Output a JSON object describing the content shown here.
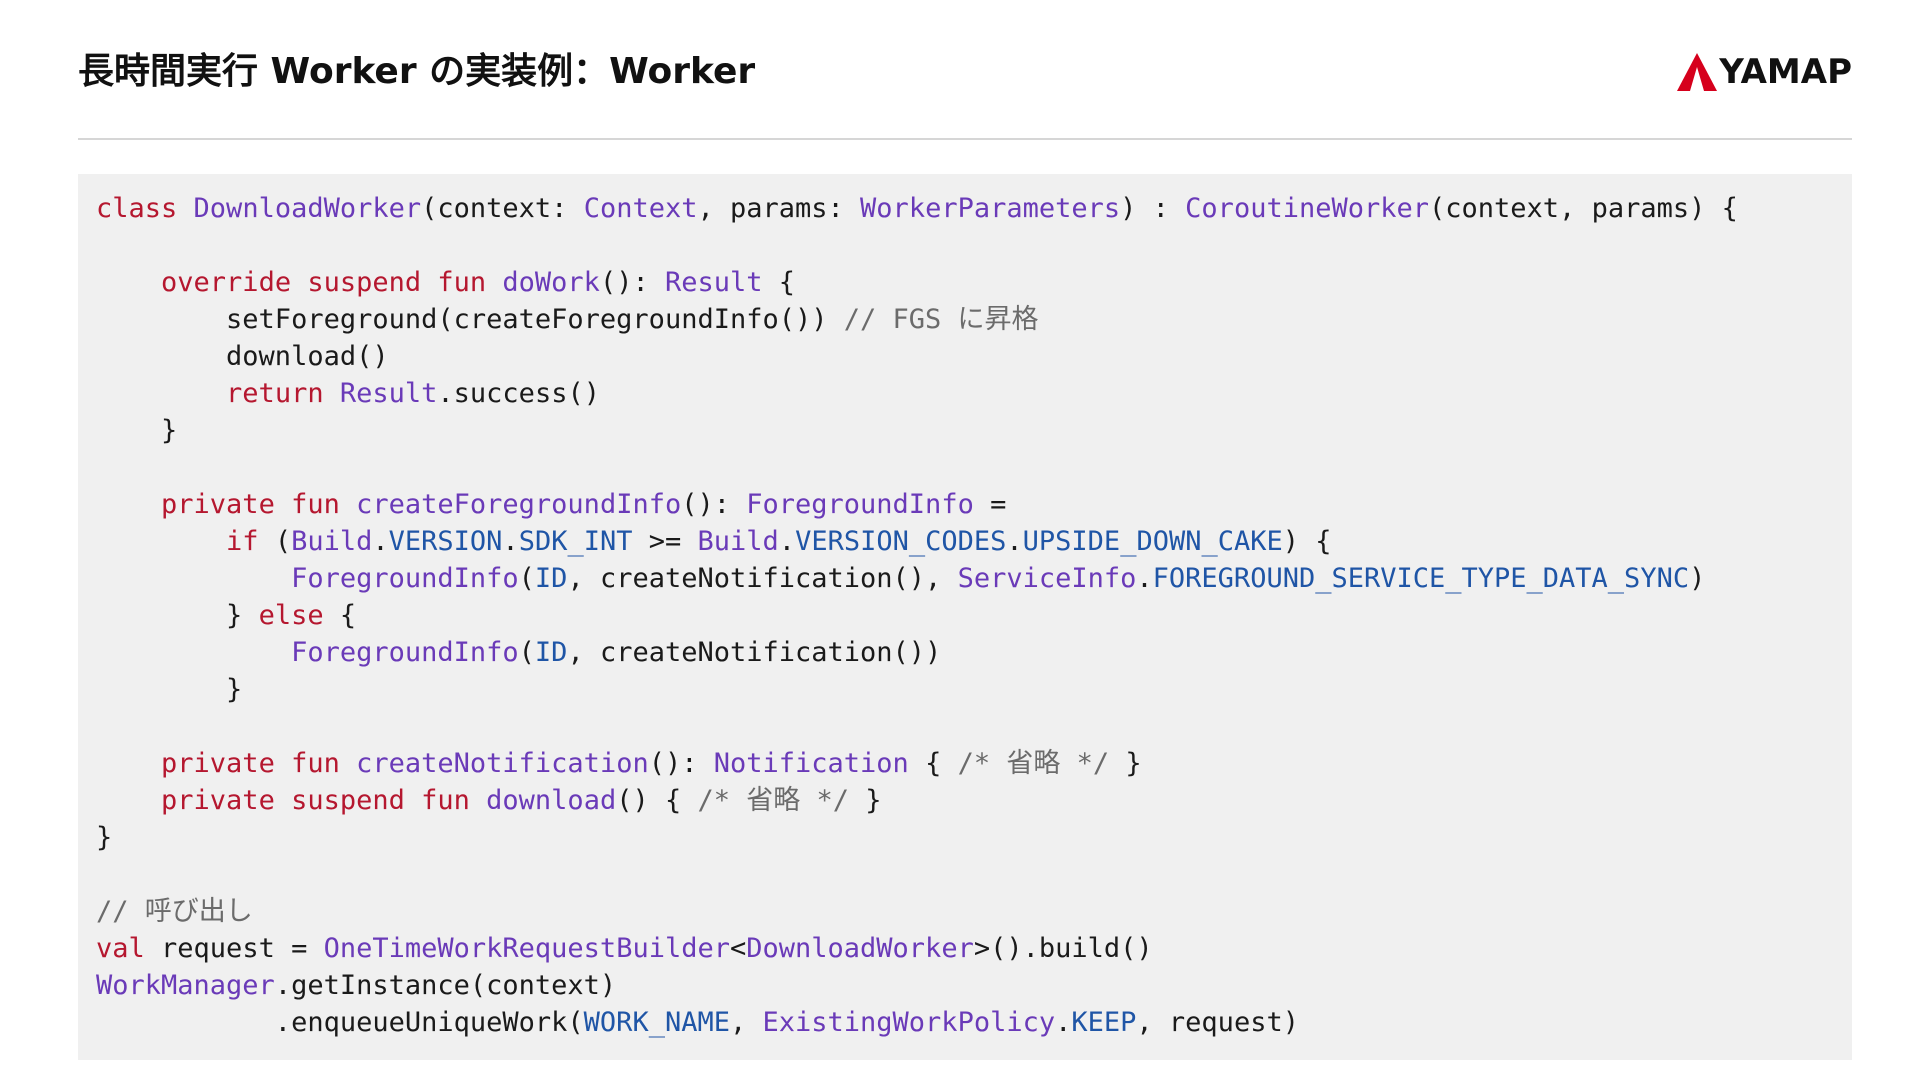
{
  "slide": {
    "title": "長時間実行 Worker の実装例：Worker",
    "logo_text": "YAMAP",
    "brand_color": "#d6001c"
  },
  "code_lines": [
    [
      {
        "t": "kw",
        "v": "class"
      },
      {
        "t": "p",
        "v": " "
      },
      {
        "t": "ty",
        "v": "DownloadWorker"
      },
      {
        "t": "p",
        "v": "(context: "
      },
      {
        "t": "ty",
        "v": "Context"
      },
      {
        "t": "p",
        "v": ", params: "
      },
      {
        "t": "ty",
        "v": "WorkerParameters"
      },
      {
        "t": "p",
        "v": ") : "
      },
      {
        "t": "ty",
        "v": "CoroutineWorker"
      },
      {
        "t": "p",
        "v": "(context, params) {"
      }
    ],
    [],
    [
      {
        "t": "p",
        "v": "    "
      },
      {
        "t": "kw",
        "v": "override suspend fun"
      },
      {
        "t": "p",
        "v": " "
      },
      {
        "t": "ty",
        "v": "doWork"
      },
      {
        "t": "p",
        "v": "(): "
      },
      {
        "t": "ty",
        "v": "Result"
      },
      {
        "t": "p",
        "v": " {"
      }
    ],
    [
      {
        "t": "p",
        "v": "        setForeground(createForegroundInfo()) "
      },
      {
        "t": "cm",
        "v": "// FGS に昇格"
      }
    ],
    [
      {
        "t": "p",
        "v": "        download()"
      }
    ],
    [
      {
        "t": "p",
        "v": "        "
      },
      {
        "t": "kw",
        "v": "return"
      },
      {
        "t": "p",
        "v": " "
      },
      {
        "t": "ty",
        "v": "Result"
      },
      {
        "t": "p",
        "v": ".success()"
      }
    ],
    [
      {
        "t": "p",
        "v": "    }"
      }
    ],
    [],
    [
      {
        "t": "p",
        "v": "    "
      },
      {
        "t": "kw",
        "v": "private fun"
      },
      {
        "t": "p",
        "v": " "
      },
      {
        "t": "ty",
        "v": "createForegroundInfo"
      },
      {
        "t": "p",
        "v": "(): "
      },
      {
        "t": "ty",
        "v": "ForegroundInfo"
      },
      {
        "t": "p",
        "v": " ="
      }
    ],
    [
      {
        "t": "p",
        "v": "        "
      },
      {
        "t": "kw",
        "v": "if"
      },
      {
        "t": "p",
        "v": " ("
      },
      {
        "t": "ty",
        "v": "Build"
      },
      {
        "t": "p",
        "v": "."
      },
      {
        "t": "cn",
        "v": "VERSION"
      },
      {
        "t": "p",
        "v": "."
      },
      {
        "t": "cn",
        "v": "SDK_INT"
      },
      {
        "t": "p",
        "v": " >= "
      },
      {
        "t": "ty",
        "v": "Build"
      },
      {
        "t": "p",
        "v": "."
      },
      {
        "t": "cn",
        "v": "VERSION_CODES"
      },
      {
        "t": "p",
        "v": "."
      },
      {
        "t": "cn",
        "v": "UPSIDE_DOWN_CAKE"
      },
      {
        "t": "p",
        "v": ") {"
      }
    ],
    [
      {
        "t": "p",
        "v": "            "
      },
      {
        "t": "ty",
        "v": "ForegroundInfo"
      },
      {
        "t": "p",
        "v": "("
      },
      {
        "t": "cn",
        "v": "ID"
      },
      {
        "t": "p",
        "v": ", createNotification(), "
      },
      {
        "t": "ty",
        "v": "ServiceInfo"
      },
      {
        "t": "p",
        "v": "."
      },
      {
        "t": "cn",
        "v": "FOREGROUND_SERVICE_TYPE_DATA_SYNC"
      },
      {
        "t": "p",
        "v": ")"
      }
    ],
    [
      {
        "t": "p",
        "v": "        } "
      },
      {
        "t": "kw",
        "v": "else"
      },
      {
        "t": "p",
        "v": " {"
      }
    ],
    [
      {
        "t": "p",
        "v": "            "
      },
      {
        "t": "ty",
        "v": "ForegroundInfo"
      },
      {
        "t": "p",
        "v": "("
      },
      {
        "t": "cn",
        "v": "ID"
      },
      {
        "t": "p",
        "v": ", createNotification())"
      }
    ],
    [
      {
        "t": "p",
        "v": "        }"
      }
    ],
    [],
    [
      {
        "t": "p",
        "v": "    "
      },
      {
        "t": "kw",
        "v": "private fun"
      },
      {
        "t": "p",
        "v": " "
      },
      {
        "t": "ty",
        "v": "createNotification"
      },
      {
        "t": "p",
        "v": "(): "
      },
      {
        "t": "ty",
        "v": "Notification"
      },
      {
        "t": "p",
        "v": " { "
      },
      {
        "t": "cm",
        "v": "/* 省略 */"
      },
      {
        "t": "p",
        "v": " }"
      }
    ],
    [
      {
        "t": "p",
        "v": "    "
      },
      {
        "t": "kw",
        "v": "private suspend fun"
      },
      {
        "t": "p",
        "v": " "
      },
      {
        "t": "ty",
        "v": "download"
      },
      {
        "t": "p",
        "v": "() { "
      },
      {
        "t": "cm",
        "v": "/* 省略 */"
      },
      {
        "t": "p",
        "v": " }"
      }
    ],
    [
      {
        "t": "p",
        "v": "}"
      }
    ],
    [],
    [
      {
        "t": "cm",
        "v": "// 呼び出し"
      }
    ],
    [
      {
        "t": "kw",
        "v": "val"
      },
      {
        "t": "p",
        "v": " request = "
      },
      {
        "t": "ty",
        "v": "OneTimeWorkRequestBuilder"
      },
      {
        "t": "p",
        "v": "<"
      },
      {
        "t": "ty",
        "v": "DownloadWorker"
      },
      {
        "t": "p",
        "v": ">().build()"
      }
    ],
    [
      {
        "t": "ty",
        "v": "WorkManager"
      },
      {
        "t": "p",
        "v": ".getInstance(context)"
      }
    ],
    [
      {
        "t": "p",
        "v": "           .enqueueUniqueWork("
      },
      {
        "t": "cn",
        "v": "WORK_NAME"
      },
      {
        "t": "p",
        "v": ", "
      },
      {
        "t": "ty",
        "v": "ExistingWorkPolicy"
      },
      {
        "t": "p",
        "v": "."
      },
      {
        "t": "cn",
        "v": "KEEP"
      },
      {
        "t": "p",
        "v": ", request)"
      }
    ]
  ]
}
